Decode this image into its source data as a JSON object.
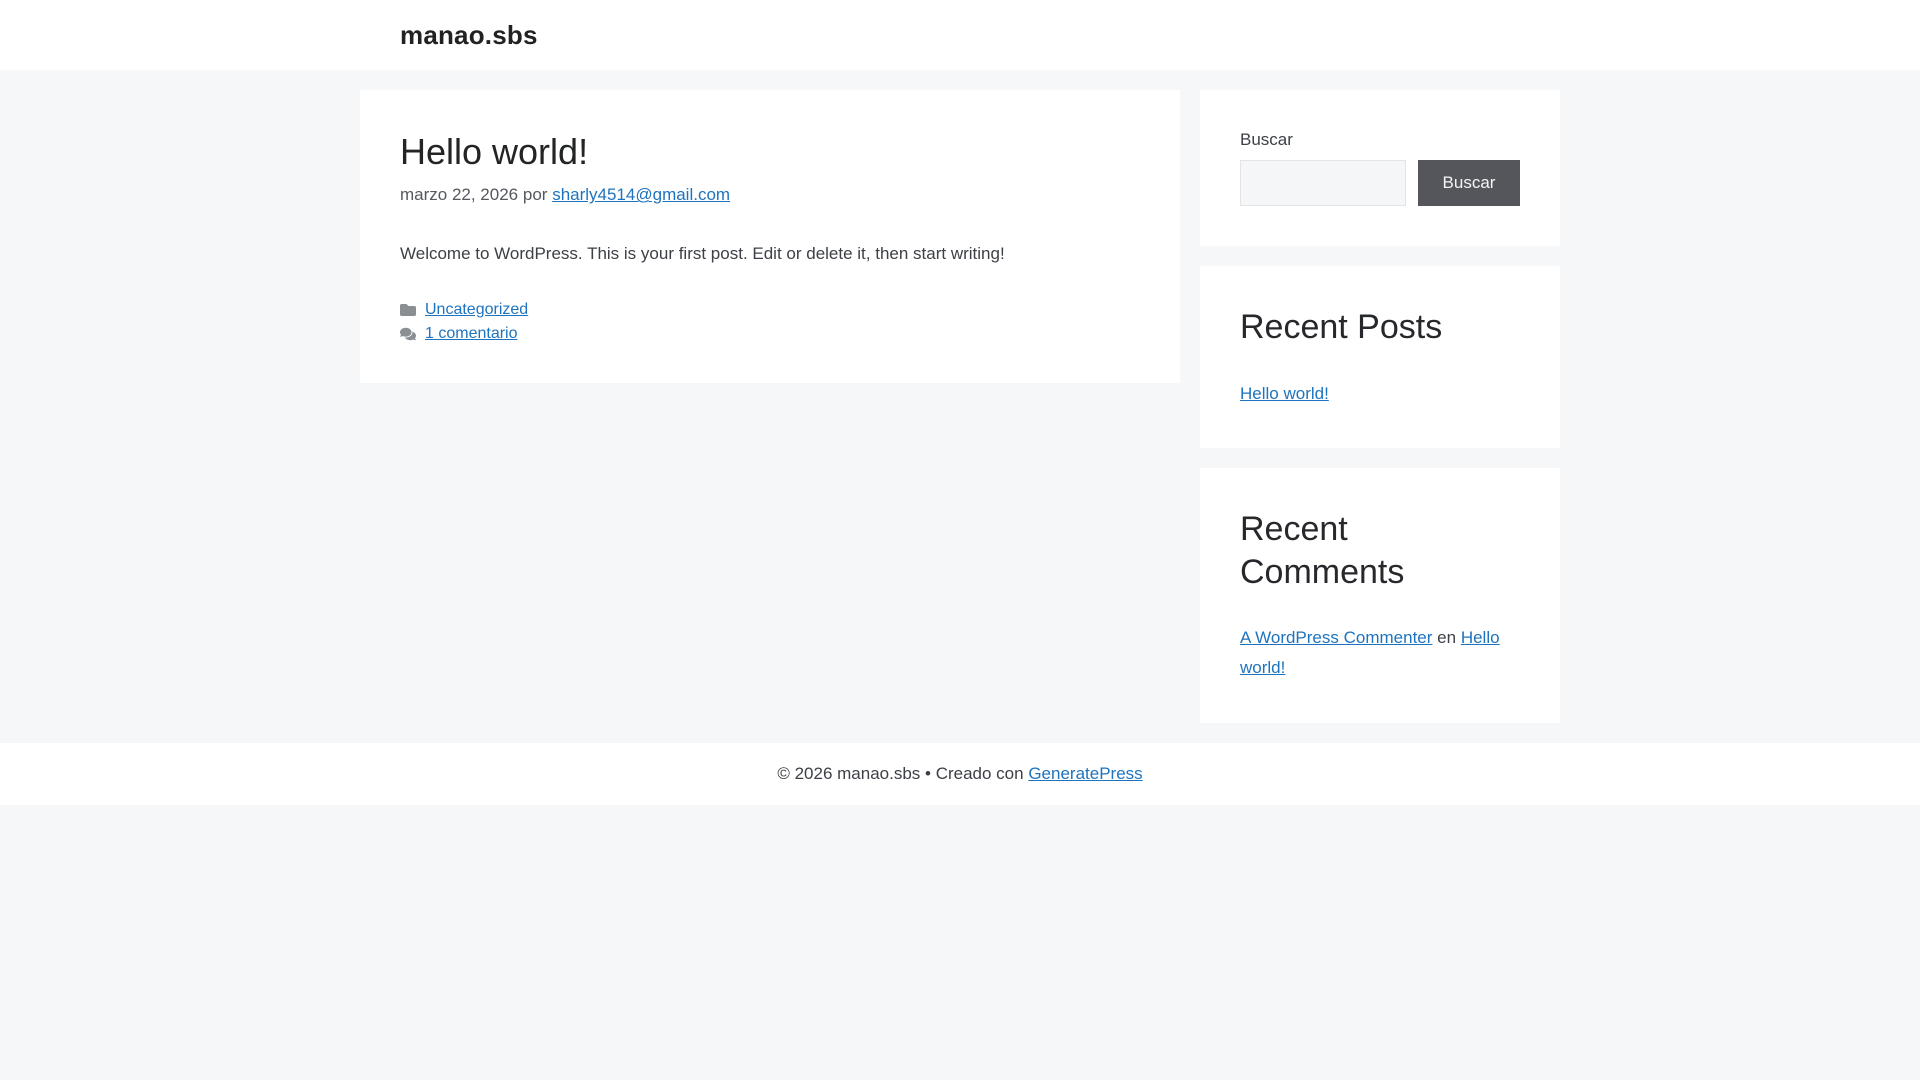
{
  "site": {
    "title": "manao.sbs"
  },
  "post": {
    "title": "Hello world!",
    "date": "marzo 22, 2026",
    "byline_separator": "por",
    "author": "sharly4514@gmail.com",
    "content": "Welcome to WordPress. This is your first post. Edit or delete it, then start writing!",
    "category": "Uncategorized",
    "comments_label": "1 comentario"
  },
  "sidebar": {
    "search": {
      "label": "Buscar",
      "input_value": "",
      "placeholder": "",
      "button_label": "Buscar"
    },
    "recent_posts": {
      "title": "Recent Posts",
      "items": [
        {
          "label": "Hello world!"
        }
      ]
    },
    "recent_comments": {
      "title": "Recent Comments",
      "items": [
        {
          "author": "A WordPress Commenter",
          "separator": "en",
          "post": "Hello world!"
        }
      ]
    }
  },
  "footer": {
    "copyright": "© 2026 manao.sbs",
    "separator": "•",
    "credit_prefix": "Creado con",
    "credit_link": "GeneratePress"
  },
  "icons": {
    "category": "folder-icon",
    "comments": "comments-icon"
  },
  "colors": {
    "background": "#f6f7f9",
    "surface": "#ffffff",
    "link": "#1e73be",
    "button_background": "#54565c",
    "button_text": "#f3f4f5",
    "heading_text": "#26282c",
    "body_text": "#3d4046",
    "meta_text": "#55585e",
    "icon_gray": "#8a8f94",
    "input_background": "#f5f6f8",
    "input_border": "#e2e4e8"
  }
}
